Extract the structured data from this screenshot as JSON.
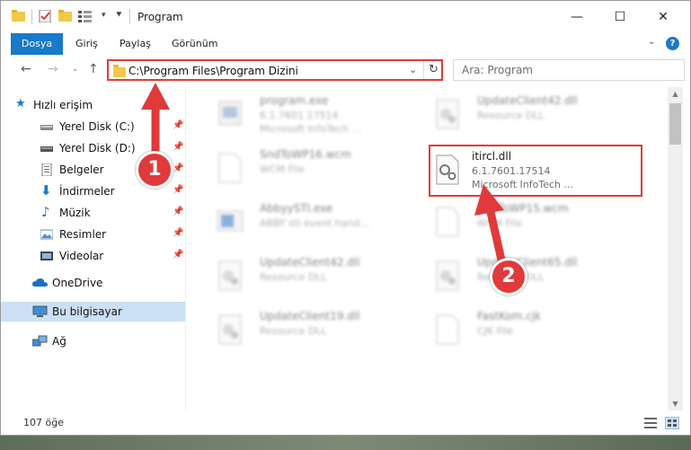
{
  "window": {
    "title": "Program",
    "controls": {
      "minimize": "—",
      "maximize": "☐",
      "close": "✕"
    }
  },
  "ribbon": {
    "tabs": [
      "Dosya",
      "Giriş",
      "Paylaş",
      "Görünüm"
    ]
  },
  "address": {
    "path": "C:\\Program Files\\Program Dizini",
    "search_placeholder": "Ara: Program"
  },
  "sidebar": {
    "items": [
      {
        "label": "Hızlı erişim",
        "icon": "star-icon",
        "pinned": false
      },
      {
        "label": "Yerel Disk (C:)",
        "icon": "drive-icon",
        "pinned": true
      },
      {
        "label": "Yerel Disk (D:)",
        "icon": "drive-icon",
        "pinned": true
      },
      {
        "label": "Belgeler",
        "icon": "documents-icon",
        "pinned": true
      },
      {
        "label": "İndirmeler",
        "icon": "download-icon",
        "pinned": true
      },
      {
        "label": "Müzik",
        "icon": "music-icon",
        "pinned": true
      },
      {
        "label": "Resimler",
        "icon": "pictures-icon",
        "pinned": true
      },
      {
        "label": "Videolar",
        "icon": "videos-icon",
        "pinned": true
      },
      {
        "label": "OneDrive",
        "icon": "cloud-icon",
        "pinned": false
      },
      {
        "label": "Bu bilgisayar",
        "icon": "computer-icon",
        "pinned": false,
        "selected": true
      },
      {
        "label": "Ağ",
        "icon": "network-icon",
        "pinned": false
      }
    ]
  },
  "files": [
    {
      "name": "program.exe",
      "line1": "6.1.7601.17514",
      "line2": "Microsoft InfoTech ...",
      "icon": "exe-icon"
    },
    {
      "name": "UpdateClient42.dll",
      "line1": "Resource DLL",
      "line2": "",
      "icon": "dll-icon"
    },
    {
      "name": "SndToWP16.wcm",
      "line1": "WCM File",
      "line2": "",
      "icon": "file-icon"
    },
    {
      "name": "itircl.dll",
      "line1": "6.1.7601.17514",
      "line2": "Microsoft InfoTech ...",
      "icon": "dll-icon"
    },
    {
      "name": "AbbyySTI.exe",
      "line1": "ABBY sti event hand...",
      "line2": "",
      "icon": "exe-icon"
    },
    {
      "name": "SndToWP15.wcm",
      "line1": "WCM File",
      "line2": "",
      "icon": "file-icon"
    },
    {
      "name": "UpdateClient42.dll",
      "line1": "Resource DLL",
      "line2": "",
      "icon": "dll-icon"
    },
    {
      "name": "UpdateClient65.dll",
      "line1": "Resource DLL",
      "line2": "",
      "icon": "dll-icon"
    },
    {
      "name": "UpdateClient19.dll",
      "line1": "Resource DLL",
      "line2": "",
      "icon": "dll-icon"
    },
    {
      "name": "FastKom.cjk",
      "line1": "CJK File",
      "line2": "",
      "icon": "file-icon"
    }
  ],
  "status": {
    "count": "107 öğe"
  },
  "annotations": {
    "badge1": "1",
    "badge2": "2"
  },
  "colors": {
    "accent": "#1979ca",
    "highlight": "#e03a3a",
    "selection": "#cce0f5"
  }
}
